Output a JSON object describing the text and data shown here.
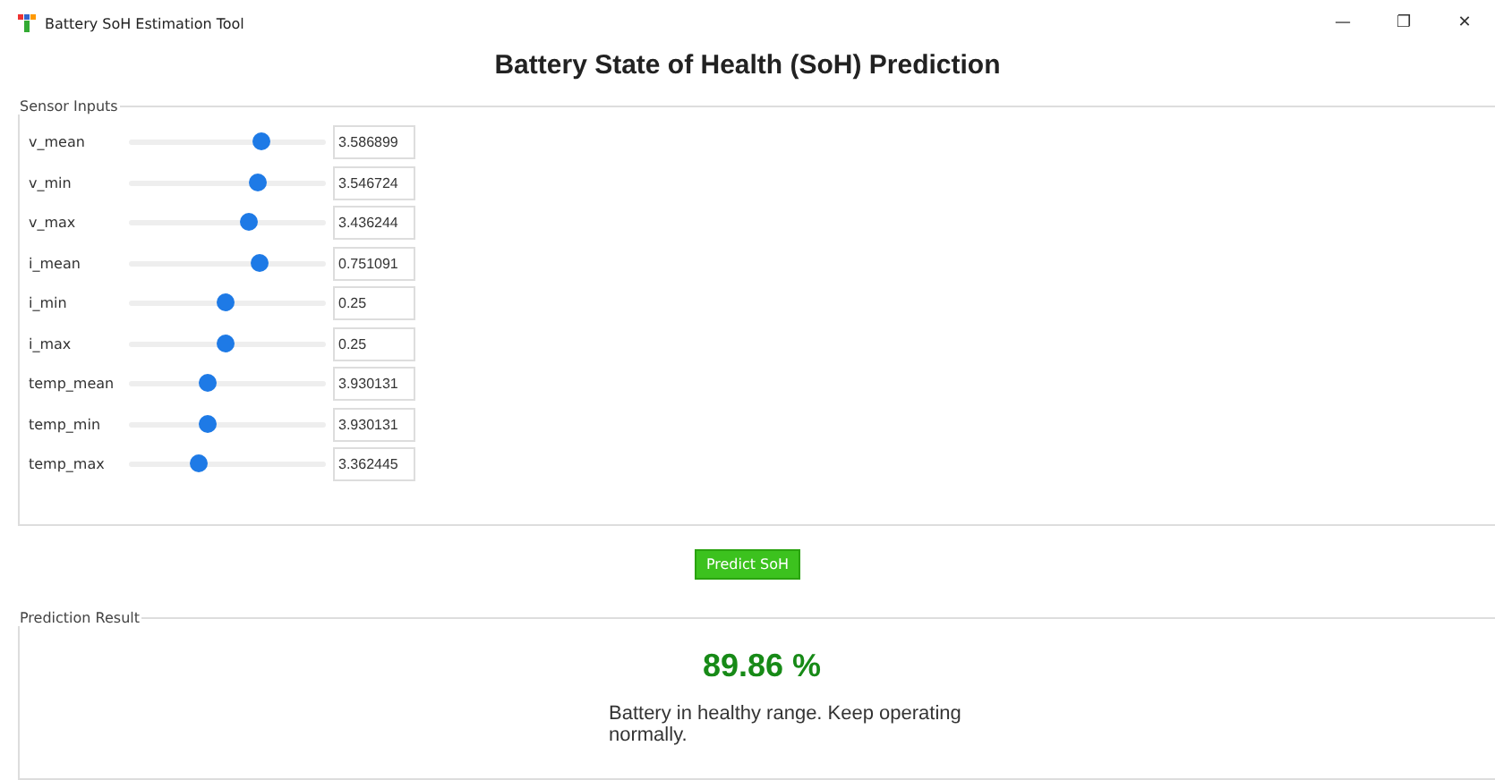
{
  "window": {
    "title": "Battery SoH Estimation Tool",
    "controls": [
      "—",
      "❐",
      "✕"
    ]
  },
  "heading": "Battery State of Health (SoH) Prediction",
  "sensor_inputs": {
    "title": "Sensor Inputs",
    "rows": [
      {
        "label": "v_mean",
        "level": 0.67,
        "value": "3.586899"
      },
      {
        "label": "v_min",
        "level": 0.65,
        "value": "3.546724"
      },
      {
        "label": "v_max",
        "level": 0.61,
        "value": "3.436244"
      },
      {
        "label": "i_mean",
        "level": 0.66,
        "value": "0.751091"
      },
      {
        "label": "i_min",
        "level": 0.49,
        "value": "0.25"
      },
      {
        "label": "i_max",
        "level": 0.49,
        "value": "0.25"
      },
      {
        "label": "temp_mean",
        "level": 0.4,
        "value": "3.930131"
      },
      {
        "label": "temp_min",
        "level": 0.4,
        "value": "3.930131"
      },
      {
        "label": "temp_max",
        "level": 0.35,
        "value": "3.362445"
      }
    ]
  },
  "predict_button": "Predict SoH",
  "prediction_result": {
    "title": "Prediction Result",
    "value": "89.86 %",
    "message": "Battery in healthy range. Keep operating normally."
  }
}
